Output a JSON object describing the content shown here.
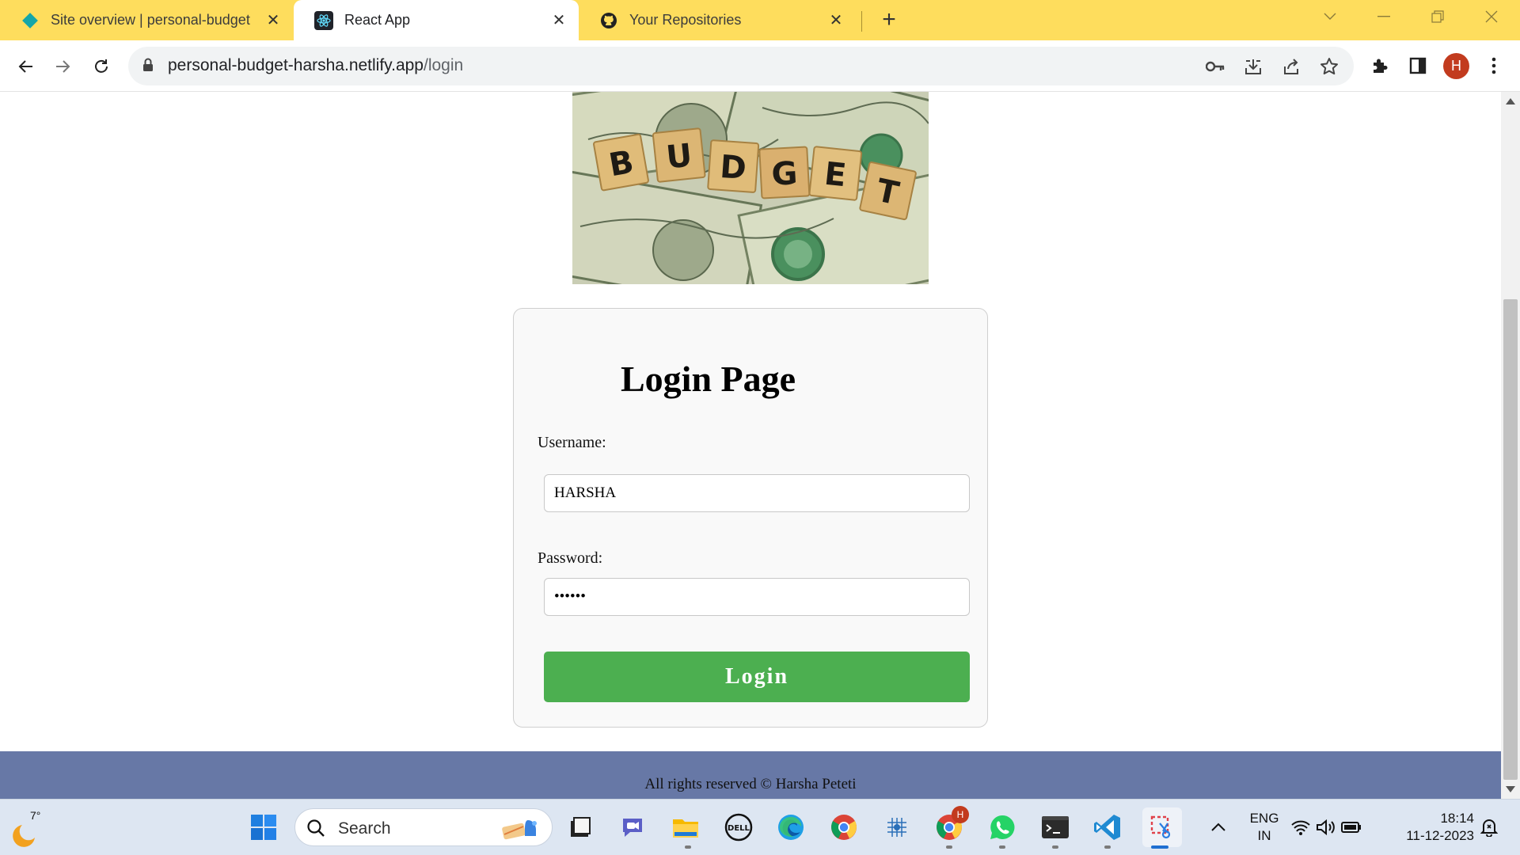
{
  "browser": {
    "tabs": [
      {
        "title": "Site overview | personal-budget",
        "icon": "netlify-diamond-icon",
        "active": false
      },
      {
        "title": "React App",
        "icon": "react-icon",
        "active": true
      },
      {
        "title": "Your Repositories",
        "icon": "github-icon",
        "active": false
      }
    ],
    "url_host": "personal-budget-harsha.netlify.app",
    "url_path": "/login",
    "profile_initial": "H"
  },
  "page": {
    "banner_letters": [
      "B",
      "U",
      "D",
      "G",
      "E",
      "T"
    ],
    "heading": "Login Page",
    "username_label": "Username:",
    "username_value": "HARSHA",
    "password_label": "Password:",
    "password_value": "••••••",
    "login_button": "Login",
    "footer_text": "All rights reserved © Harsha Peteti"
  },
  "taskbar": {
    "weather_temp": "7°",
    "search_placeholder": "Search",
    "lang_top": "ENG",
    "lang_bottom": "IN",
    "time": "18:14",
    "date": "11-12-2023",
    "chrome_badge": "H"
  },
  "colors": {
    "tabstrip": "#fedd5d",
    "login_button": "#4caf50",
    "footer": "#6778a6"
  }
}
